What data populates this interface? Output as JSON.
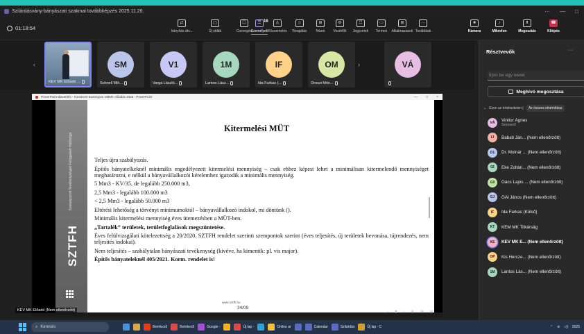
{
  "window": {
    "title": "Szilárdásvány-bányászati szakmai továbbképzés 2025.11.26.",
    "controls": [
      "···",
      "—",
      "□"
    ]
  },
  "meeting": {
    "timer": "01:18:54",
    "toolbar": [
      {
        "label": "Irányítás átv..."
      },
      {
        "label": "Új aldák"
      },
      {
        "label": "Csevegés"
      },
      {
        "label": "Személyek",
        "count": "16",
        "active": true
      },
      {
        "label": "Közzemelés"
      },
      {
        "label": "Reagálás"
      },
      {
        "label": "Nézet"
      },
      {
        "label": "Vezérlők"
      },
      {
        "label": "Jegyzetek"
      },
      {
        "label": "Termek"
      },
      {
        "label": "Alkalmazások"
      },
      {
        "label": "Továbbiak"
      },
      {
        "label": "Kamera",
        "bold": true
      },
      {
        "label": "Mikrofon",
        "bold": true
      },
      {
        "label": "Megosztás",
        "bold": true
      },
      {
        "label": "Kilépés",
        "bold": true
      }
    ]
  },
  "strip": {
    "tiles": [
      {
        "name": "KEV MK Előadó ...",
        "initials": "",
        "color": ""
      },
      {
        "name": "Schnell Mih...",
        "initials": "SM",
        "color": "#b9c6ea"
      },
      {
        "name": "Varga László...",
        "initials": "V1",
        "color": "#c7c8f5"
      },
      {
        "name": "Lantos Lász...",
        "initials": "1M",
        "color": "#a6d8c0"
      },
      {
        "name": "Ida Farkas (...",
        "initials": "IF",
        "color": "#ffd28a"
      },
      {
        "name": "Oroszi Món...",
        "initials": "OM",
        "color": "#d7e8a4"
      },
      {
        "name": "",
        "initials": "VÁ",
        "color": "#e7bde3"
      }
    ]
  },
  "presentation": {
    "window_title": "PowerPoint-diavetítés  -  Komárom-Esztergom VMMK előadás 2025 - PowerPoint",
    "heading": "Kitermelési MÜT",
    "sidebar_org": "Szabályozott Tevékenységek Felügyeleti Hatósága",
    "sidebar_brand": "SZTFH",
    "lines": [
      {
        "text": "Teljes újra szabályozás.",
        "bold": false
      },
      {
        "text": "Építős bányatelkeknél minimális engedélyezett kitermelési mennyiség – csak ehhez képest lehet a minimálisan kitermelendő mennyiséget meghatározni, e nélkül a bányavállalkozói kérelemhez igazodik a minimális mennyiség.",
        "bold": false
      },
      {
        "text": "5 Mm3 - KV/35, de legalább 250.000 m3,",
        "bold": false
      },
      {
        "text": "2,5 Mm3 - legalább 100.000 m3",
        "bold": false
      },
      {
        "text": "< 2,5 Mm3 - legalább 50.000 m3",
        "bold": false
      },
      {
        "text": "Eltérési lehetőség a törvényi minimumoktól – bányavállalkozó indokol, mi döntünk ().",
        "bold": false
      },
      {
        "text": "Minimális kitermelési mennyiség éves ütemezésben a MÜT-ben.",
        "bold": false
      },
      {
        "text": "„Tartalék” területek, területfoglalások megszüntetése.",
        "bold": true
      },
      {
        "text": "Éves felülvizsgálati kötelezettség a 20/2020. SZTFH rendelet szerinti szempontok szerint (éves teljesítés, új területek bevonása, tájrendezés, nem teljesítés indokai).",
        "bold": false
      },
      {
        "text": "Nem teljesítés – szabálytalan bányászati tevékenység (kivéve, ha kimentik: pl. vis major).",
        "bold": false
      },
      {
        "text": "Építős bányateleknél 405/2021. Korm. rendelet is!",
        "bold": true
      }
    ],
    "url": "www.sztfh.hu",
    "page": "34/09",
    "presenter_label": "KEV MK Előadó (Nem ellenőrzött)"
  },
  "panel": {
    "title": "Résztvevők",
    "more": "···",
    "search_placeholder": "Írjon be egy nevet",
    "share_button": "Meghívó megosztása",
    "filter_label": "Ezen az értekezleten (",
    "filter_chip": "Az összes elnémítása",
    "participants": [
      {
        "initials": "VÁ",
        "name": "Vinitor Ágnes",
        "sub": "Szervező",
        "color": "#e7bde3",
        "bold": false
      },
      {
        "initials": "IJ",
        "name": "Babati Ján... (Nem ellenőrzött)",
        "sub": "",
        "color": "#f4b1a1",
        "bold": false
      },
      {
        "initials": "D1",
        "name": "Dr. Molnár ... (Nem ellenőrzött)",
        "sub": "",
        "color": "#b5c9f2",
        "bold": false
      },
      {
        "initials": "0Z",
        "name": "Eke Zoltán... (Nem ellenőrzött)",
        "sub": "",
        "color": "#a6d8c0",
        "bold": false
      },
      {
        "initials": "G0",
        "name": "Gács Lajos ... (Nem ellenőrzött)",
        "sub": "",
        "color": "#bfe3a4",
        "bold": false
      },
      {
        "initials": "GJ",
        "name": "GÁl János (Nem ellenőrzött)",
        "sub": "",
        "color": "#b9c6ea",
        "bold": false
      },
      {
        "initials": "IF",
        "name": "Ida Farkas (Külső)",
        "sub": "",
        "color": "#ffd28a",
        "bold": false
      },
      {
        "initials": "KT",
        "name": "KEM MK Titkárság",
        "sub": "",
        "color": "#a6d8c0",
        "bold": false
      },
      {
        "initials": "KE",
        "name": "KEV MK E... (Nem ellenőrzött)",
        "sub": "",
        "color": "#f4b1c4",
        "bold": true
      },
      {
        "initials": "OP",
        "name": "Kis Hercze... (Nem ellenőrzött)",
        "sub": "",
        "color": "#ffd28a",
        "bold": false
      },
      {
        "initials": "1M",
        "name": "Lantos Lás... (Nem ellenőrzött)",
        "sub": "",
        "color": "#a6d8c0",
        "bold": false
      }
    ]
  },
  "taskbar": {
    "search": "Keresés",
    "apps": [
      {
        "label": "",
        "color": "#4a90d9"
      },
      {
        "label": "",
        "color": "#d9a74a"
      },
      {
        "label": "Beérkező",
        "color": "#e0401a"
      },
      {
        "label": "Beérkező",
        "color": "#d94a4a"
      },
      {
        "label": "Google -",
        "color": "#a050d0"
      },
      {
        "label": "",
        "color": "#f0b020"
      },
      {
        "label": "Új lap -",
        "color": "#d94a4a"
      },
      {
        "label": "",
        "color": "#33a0d0"
      },
      {
        "label": "Online ar",
        "color": "#f0c040"
      },
      {
        "label": "",
        "color": "#5a6ac0"
      },
      {
        "label": "Calendar",
        "color": "#5a6ac0"
      },
      {
        "label": "Szilárdás",
        "color": "#5a6ac0"
      },
      {
        "label": "Új lap - C",
        "color": "#d0a030"
      }
    ],
    "tray": "2025"
  }
}
